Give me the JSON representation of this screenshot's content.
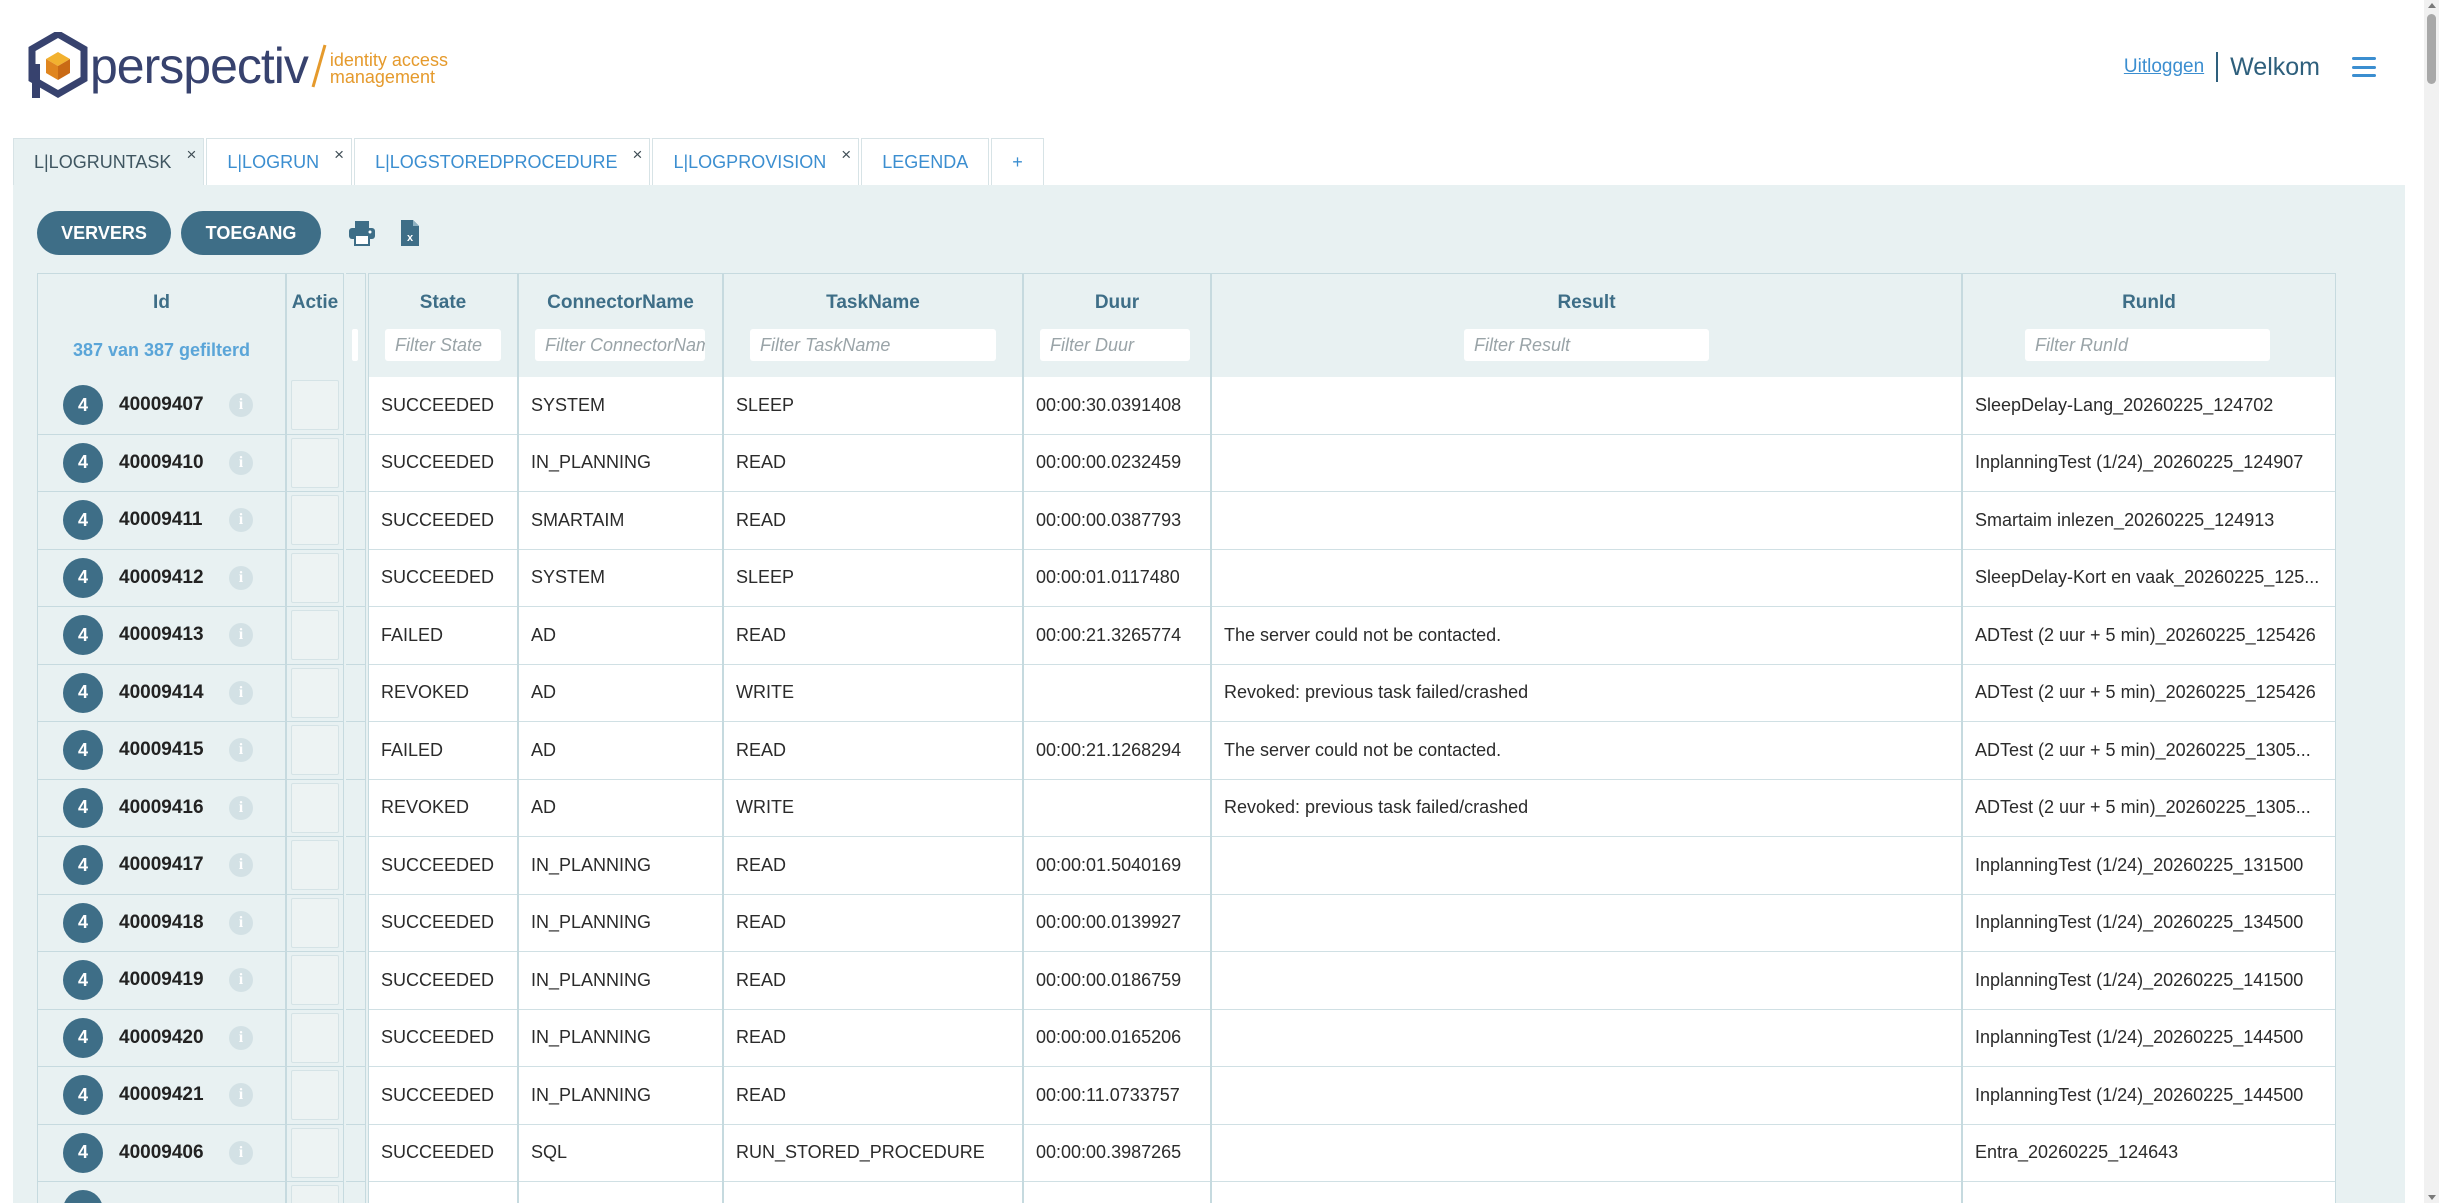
{
  "brand": {
    "name": "perspectiv",
    "tagline_line1": "identity access",
    "tagline_line2": "management",
    "colors": {
      "primary": "#37426e",
      "accent": "#e59a2c"
    }
  },
  "header": {
    "logout_label": "Uitloggen",
    "welcome_label": "Welkom",
    "menu_icon": "hamburger-menu-icon"
  },
  "tabs": [
    {
      "label": "L|LOGRUNTASK",
      "active": true,
      "closable": true
    },
    {
      "label": "L|LOGRUN",
      "active": false,
      "closable": true
    },
    {
      "label": "L|LOGSTOREDPROCEDURE",
      "active": false,
      "closable": true
    },
    {
      "label": "L|LOGPROVISION",
      "active": false,
      "closable": true
    },
    {
      "label": "LEGENDA",
      "active": false,
      "closable": false
    },
    {
      "label": "+",
      "active": false,
      "closable": false
    }
  ],
  "tab_close_glyph": "×",
  "toolbar": {
    "refresh_label": "VERVERS",
    "access_label": "TOEGANG",
    "print_icon": "print-icon",
    "excel_icon": "excel-export-icon"
  },
  "grid": {
    "columns": {
      "id": {
        "title": "Id",
        "count_label": "387 van 387 gefilterd"
      },
      "action": {
        "title": "Actie"
      },
      "state": {
        "title": "State",
        "filter_placeholder": "Filter State"
      },
      "connector": {
        "title": "ConnectorName",
        "filter_placeholder": "Filter ConnectorName"
      },
      "task": {
        "title": "TaskName",
        "filter_placeholder": "Filter TaskName"
      },
      "duration": {
        "title": "Duur",
        "filter_placeholder": "Filter Duur"
      },
      "result": {
        "title": "Result",
        "filter_placeholder": "Filter Result"
      },
      "runid": {
        "title": "RunId",
        "filter_placeholder": "Filter RunId"
      }
    },
    "rows": [
      {
        "badge": "4",
        "id": "40009407",
        "state": "SUCCEEDED",
        "connector": "SYSTEM",
        "task": "SLEEP",
        "duration": "00:00:30.0391408",
        "result": "",
        "runid": "SleepDelay-Lang_20260225_124702"
      },
      {
        "badge": "4",
        "id": "40009410",
        "state": "SUCCEEDED",
        "connector": "IN_PLANNING",
        "task": "READ",
        "duration": "00:00:00.0232459",
        "result": "",
        "runid": "InplanningTest (1/24)_20260225_124907"
      },
      {
        "badge": "4",
        "id": "40009411",
        "state": "SUCCEEDED",
        "connector": "SMARTAIM",
        "task": "READ",
        "duration": "00:00:00.0387793",
        "result": "",
        "runid": "Smartaim inlezen_20260225_124913"
      },
      {
        "badge": "4",
        "id": "40009412",
        "state": "SUCCEEDED",
        "connector": "SYSTEM",
        "task": "SLEEP",
        "duration": "00:00:01.0117480",
        "result": "",
        "runid": "SleepDelay-Kort en vaak_20260225_125..."
      },
      {
        "badge": "4",
        "id": "40009413",
        "state": "FAILED",
        "connector": "AD",
        "task": "READ",
        "duration": "00:00:21.3265774",
        "result": "The server could not be contacted.",
        "runid": "ADTest (2 uur + 5 min)_20260225_125426"
      },
      {
        "badge": "4",
        "id": "40009414",
        "state": "REVOKED",
        "connector": "AD",
        "task": "WRITE",
        "duration": "",
        "result": "Revoked: previous task failed/crashed",
        "runid": "ADTest (2 uur + 5 min)_20260225_125426"
      },
      {
        "badge": "4",
        "id": "40009415",
        "state": "FAILED",
        "connector": "AD",
        "task": "READ",
        "duration": "00:00:21.1268294",
        "result": "The server could not be contacted.",
        "runid": "ADTest (2 uur + 5 min)_20260225_1305..."
      },
      {
        "badge": "4",
        "id": "40009416",
        "state": "REVOKED",
        "connector": "AD",
        "task": "WRITE",
        "duration": "",
        "result": "Revoked: previous task failed/crashed",
        "runid": "ADTest (2 uur + 5 min)_20260225_1305..."
      },
      {
        "badge": "4",
        "id": "40009417",
        "state": "SUCCEEDED",
        "connector": "IN_PLANNING",
        "task": "READ",
        "duration": "00:00:01.5040169",
        "result": "",
        "runid": "InplanningTest (1/24)_20260225_131500"
      },
      {
        "badge": "4",
        "id": "40009418",
        "state": "SUCCEEDED",
        "connector": "IN_PLANNING",
        "task": "READ",
        "duration": "00:00:00.0139927",
        "result": "",
        "runid": "InplanningTest (1/24)_20260225_134500"
      },
      {
        "badge": "4",
        "id": "40009419",
        "state": "SUCCEEDED",
        "connector": "IN_PLANNING",
        "task": "READ",
        "duration": "00:00:00.0186759",
        "result": "",
        "runid": "InplanningTest (1/24)_20260225_141500"
      },
      {
        "badge": "4",
        "id": "40009420",
        "state": "SUCCEEDED",
        "connector": "IN_PLANNING",
        "task": "READ",
        "duration": "00:00:00.0165206",
        "result": "",
        "runid": "InplanningTest (1/24)_20260225_144500"
      },
      {
        "badge": "4",
        "id": "40009421",
        "state": "SUCCEEDED",
        "connector": "IN_PLANNING",
        "task": "READ",
        "duration": "00:00:11.0733757",
        "result": "",
        "runid": "InplanningTest (1/24)_20260225_144500"
      },
      {
        "badge": "4",
        "id": "40009406",
        "state": "SUCCEEDED",
        "connector": "SQL",
        "task": "RUN_STORED_PROCEDURE",
        "duration": "00:00:00.3987265",
        "result": "",
        "runid": "Entra_20260225_124643"
      }
    ]
  }
}
